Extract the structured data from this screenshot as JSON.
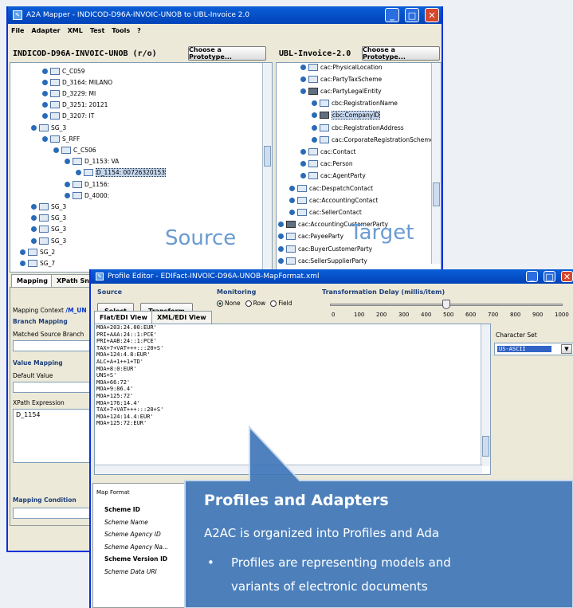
{
  "main_window": {
    "title": "A2A Mapper - INDICOD-D96A-INVOIC-UNOB to UBL-Invoice 2.0",
    "menu": [
      "File",
      "Adapter",
      "XML",
      "Test",
      "Tools",
      "?"
    ]
  },
  "source": {
    "header": "INDICOD-D96A-INVOIC-UNOB (r/o)",
    "button": "Choose a Prototype...",
    "watermark": "Source",
    "tree": [
      {
        "label": "C_C059",
        "indent": 40,
        "icon": "f"
      },
      {
        "label": "D_3164: MILANO",
        "indent": 40,
        "icon": "f"
      },
      {
        "label": "D_3229: MI",
        "indent": 40,
        "icon": "f"
      },
      {
        "label": "D_3251: 20121",
        "indent": 40,
        "icon": "f"
      },
      {
        "label": "D_3207: IT",
        "indent": 40,
        "icon": "f"
      },
      {
        "label": "SG_3",
        "indent": 26,
        "icon": "f"
      },
      {
        "label": "S_RFF",
        "indent": 40,
        "icon": "f"
      },
      {
        "label": "C_C506",
        "indent": 54,
        "icon": "f"
      },
      {
        "label": "D_1153: VA",
        "indent": 68,
        "icon": "f"
      },
      {
        "label": "D_1154: 00726320153",
        "indent": 82,
        "icon": "f",
        "selected": true
      },
      {
        "label": "D_1156:",
        "indent": 68,
        "icon": "f"
      },
      {
        "label": "D_4000:",
        "indent": 68,
        "icon": "f"
      },
      {
        "label": "SG_3",
        "indent": 26,
        "icon": "f"
      },
      {
        "label": "SG_3",
        "indent": 26,
        "icon": "f"
      },
      {
        "label": "SG_3",
        "indent": 26,
        "icon": "f"
      },
      {
        "label": "SG_3",
        "indent": 26,
        "icon": "f"
      },
      {
        "label": "SG_2",
        "indent": 12,
        "icon": "f"
      },
      {
        "label": "SG_7",
        "indent": 12,
        "icon": "f"
      }
    ]
  },
  "target": {
    "header": "UBL-Invoice-2.0",
    "button": "Choose a Prototype...",
    "watermark": "Target",
    "tree": [
      {
        "label": "cac:PhysicalLocation",
        "indent": 30,
        "icon": "f"
      },
      {
        "label": "cac:PartyTaxScheme",
        "indent": 30,
        "icon": "f"
      },
      {
        "label": "cac:PartyLegalEntity",
        "indent": 30,
        "icon": "k"
      },
      {
        "label": "cbc:RegistrationName",
        "indent": 44,
        "icon": "f"
      },
      {
        "label": "cbc:CompanyID",
        "indent": 44,
        "icon": "k",
        "selected": true
      },
      {
        "label": "cbc:RegistrationAddress",
        "indent": 44,
        "icon": "f"
      },
      {
        "label": "cac:CorporateRegistrationScheme",
        "indent": 44,
        "icon": "f"
      },
      {
        "label": "cac:Contact",
        "indent": 30,
        "icon": "f"
      },
      {
        "label": "cac:Person",
        "indent": 30,
        "icon": "f"
      },
      {
        "label": "cac:AgentParty",
        "indent": 30,
        "icon": "f"
      },
      {
        "label": "cac:DespatchContact",
        "indent": 16,
        "icon": "f"
      },
      {
        "label": "cac:AccountingContact",
        "indent": 16,
        "icon": "f"
      },
      {
        "label": "cac:SellerContact",
        "indent": 16,
        "icon": "f"
      },
      {
        "label": "cac:AccountingCustomerParty",
        "indent": 2,
        "icon": "k"
      },
      {
        "label": "cac:PayeeParty",
        "indent": 2,
        "icon": "f"
      },
      {
        "label": "cac:BuyerCustomerParty",
        "indent": 2,
        "icon": "f"
      },
      {
        "label": "cac:SellerSupplierParty",
        "indent": 2,
        "icon": "f"
      }
    ]
  },
  "mapping_panel": {
    "tabs": [
      "Mapping",
      "XPath Sni"
    ],
    "context_label": "Mapping Context",
    "context_value": "/M_UN",
    "branch_mapping": "Branch Mapping",
    "matched_label": "Matched Source Branch",
    "value_mapping": "Value Mapping",
    "default_label": "Default Value",
    "xpath_label": "XPath Expression",
    "xpath_value": "D_1154",
    "condition_label": "Mapping Condition"
  },
  "profile_editor": {
    "title": "Profile Editor - EDIFact-INVOIC-D96A-UNOB-MapFormat.xml",
    "source_label": "Source",
    "select_button": "Select",
    "transform_button": "Transform",
    "monitoring_label": "Monitoring",
    "radios": [
      {
        "label": "None",
        "checked": true
      },
      {
        "label": "Row",
        "checked": false
      },
      {
        "label": "Field",
        "checked": false
      }
    ],
    "delay_label": "Transformation Delay (millis/item)",
    "slider_ticks": [
      "0",
      "100",
      "200",
      "300",
      "400",
      "500",
      "600",
      "700",
      "800",
      "900",
      "1000"
    ],
    "slider_value": 500,
    "tabs": [
      "Flat/EDI View",
      "XML/EDI View"
    ],
    "edi_lines": [
      "MOA+203:24.00:EUR'",
      "PRI+AAA:24::1:PCE'",
      "PRI+AAB:24::1:PCE'",
      "TAX+7+VAT+++:::20+S'",
      "MOA+124:4.8:EUR'",
      "ALC+A+1++1+TD'",
      "MOA+8:0:EUR'",
      "UNS+S'",
      "MOA+66:72'",
      "MOA+9:86.4'",
      "MOA+125:72'",
      "MOA+176:14.4'",
      "TAX+7+VAT+++:::20+S'",
      "MOA+124:14.4:EUR'",
      "MOA+125:72:EUR'"
    ],
    "charset_label": "Character Set",
    "charset_value": "US-ASCII",
    "map_format": "Map Format",
    "scheme_fields": [
      {
        "label": "Scheme ID",
        "bold": true
      },
      {
        "label": "Scheme Name",
        "bold": false
      },
      {
        "label": "Scheme Agency ID",
        "bold": false
      },
      {
        "label": "Scheme Agency Na...",
        "bold": false
      },
      {
        "label": "Scheme Version ID",
        "bold": true
      },
      {
        "label": "Scheme Data URI",
        "bold": false
      }
    ]
  },
  "callout": {
    "heading": "Profiles and Adapters",
    "line1": "A2AC is organized into Profiles and Ada",
    "bullet": "Profiles are representing models and",
    "bullet_cont": "variants of electronic documents"
  }
}
